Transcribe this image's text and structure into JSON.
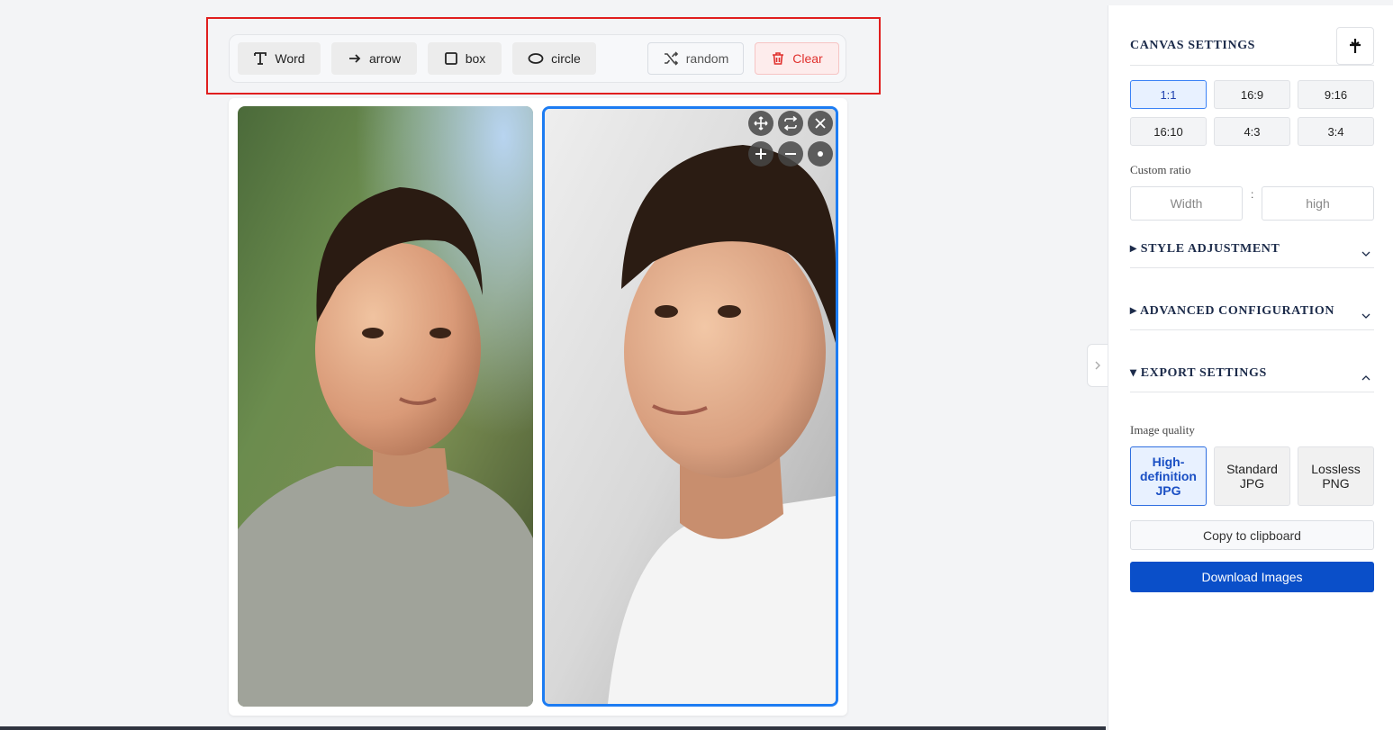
{
  "toolbar": {
    "word_label": "Word",
    "arrow_label": "arrow",
    "box_label": "box",
    "circle_label": "circle",
    "random_label": "random",
    "clear_label": "Clear"
  },
  "panel": {
    "canvas_settings_title": "CANVAS SETTINGS",
    "ratios": [
      "1:1",
      "16:9",
      "9:16",
      "16:10",
      "4:3",
      "3:4"
    ],
    "custom_ratio_label": "Custom ratio",
    "width_placeholder": "Width",
    "height_placeholder": "high",
    "colon": ":",
    "style_adjustment_title": "▸ STYLE ADJUSTMENT",
    "advanced_configuration_title": "▸ ADVANCED CONFIGURATION",
    "export_settings_title": "▾ EXPORT SETTINGS",
    "image_quality_label": "Image quality",
    "quality_options": [
      "High-definition JPG",
      "Standard JPG",
      "Lossless PNG"
    ],
    "copy_label": "Copy to clipboard",
    "download_label": "Download Images"
  },
  "colors": {
    "accent": "#0a4fc9",
    "selection": "#1d7cf2",
    "highlight_box": "#e01e1e",
    "danger": "#e0302d"
  }
}
